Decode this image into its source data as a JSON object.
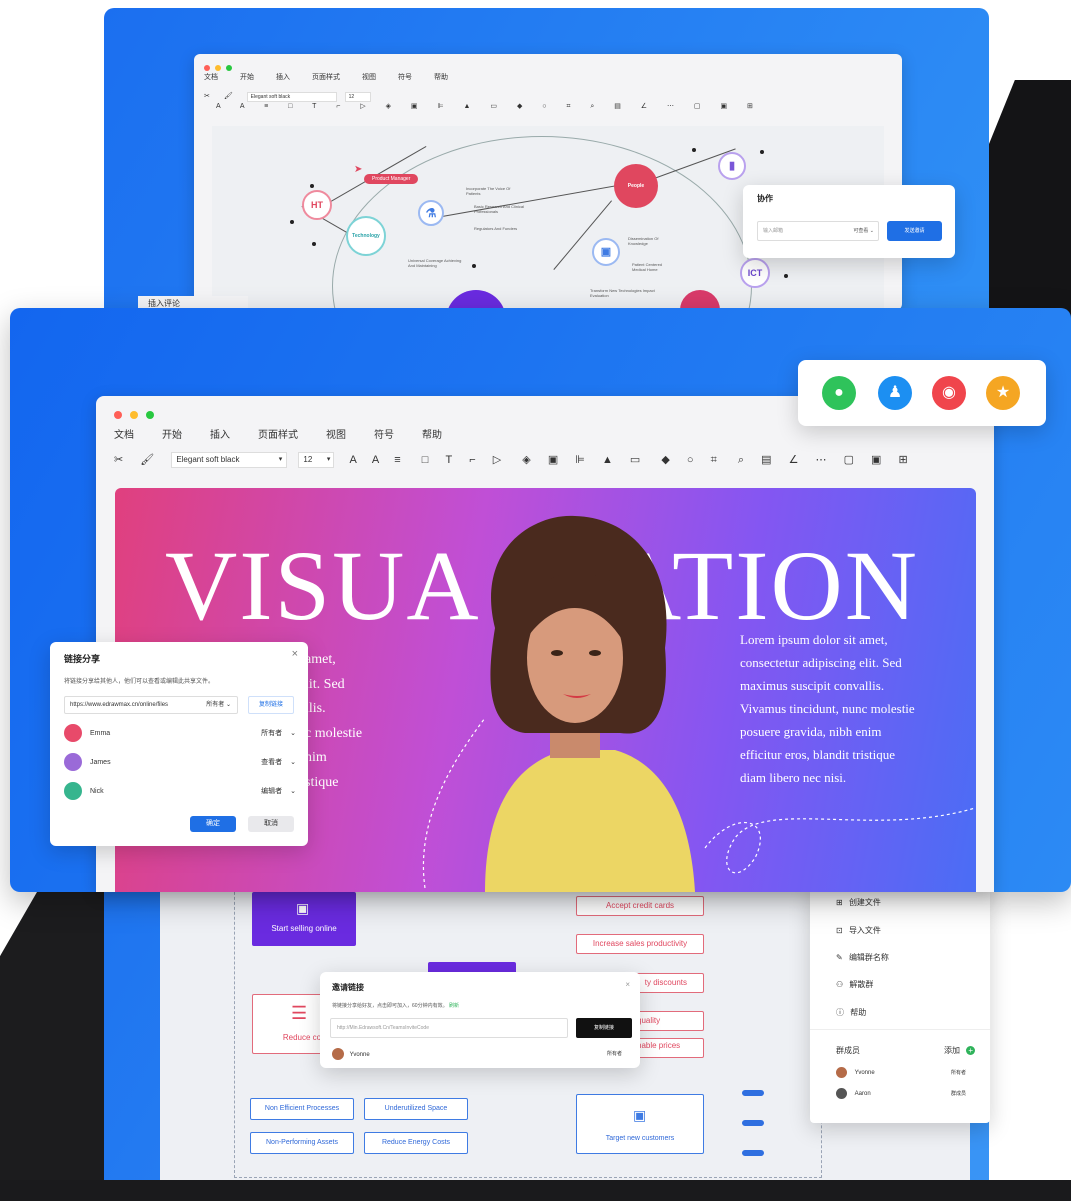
{
  "menu": [
    "文档",
    "开始",
    "插入",
    "页面样式",
    "视图",
    "符号",
    "帮助"
  ],
  "toolbar": {
    "font": "Elegant soft black",
    "size": "12"
  },
  "mindmap": {
    "nodes": {
      "ht": "HT",
      "technology": "Technology",
      "people": "People",
      "ict": "ICT",
      "product_manager": "Product Manager"
    },
    "notes": [
      "Incorporate The Voice Of Patients",
      "Basic Research And Clinical Professionals",
      "Regulators And Funders",
      "Universal Coverage Achieving And Maintaining",
      "Dissemination Of Knowledge",
      "Patient Centered Medical Home",
      "Transform New Technologies Impact Evaluation"
    ],
    "bottom_label": "插入评论"
  },
  "collab": {
    "title": "协作",
    "input_placeholder": "输入邮箱",
    "permission": "可查看",
    "send": "发送邀请"
  },
  "social": {
    "colors": [
      "#2fc35b",
      "#1c8ff2",
      "#f0454c",
      "#f5a623"
    ],
    "icons": [
      "wechat-icon",
      "qq-icon",
      "weibo-icon",
      "favorite-icon"
    ]
  },
  "hero": {
    "title_left": "VISUA",
    "title_right": "ATION",
    "body": "Lorem ipsum dolor sit amet, consectetur adipiscing elit. Sed maximus suscipit convallis. Vivamus tincidunt, nunc molestie posuere gravida, nibh enim efficitur eros, blandit tristique diam libero nec nisi.",
    "body_left_fragments": [
      "amet,",
      "lit. Sed",
      "llis.",
      "c molestie",
      "nim",
      "stique"
    ]
  },
  "share": {
    "title": "链接分享",
    "desc": "将链接分享给其他人，他们可以查看或编辑此共享文件。",
    "url": "https://www.edrawmax.cn/online/files",
    "url_perm": "所有者",
    "copy": "复制链接",
    "users": [
      {
        "name": "Emma",
        "role": "所有者",
        "color": "#e84a6a"
      },
      {
        "name": "James",
        "role": "查看者",
        "color": "#9a6ad8"
      },
      {
        "name": "Nick",
        "role": "编辑者",
        "color": "#36b58e"
      }
    ],
    "ok": "确定",
    "cancel": "取消"
  },
  "flow": {
    "start": "Start selling online",
    "reduce": "Reduce co",
    "right_boxes": [
      "Accept credit cards",
      "Increase sales productivity",
      "ty discounts",
      "quality",
      "nable prices"
    ],
    "bottom_boxes": [
      "Non Efficient Processes",
      "Underutilized Space",
      "Non-Performing Assets",
      "Reduce Energy Costs"
    ],
    "target": "Target new customers"
  },
  "invite": {
    "title": "邀请链接",
    "desc": "将链接分享给好友，点击即可加入，60分钟内有效。",
    "reset": "刷新",
    "url": "http://Min.Edrawsoft.Cn/TeamsInviteCode",
    "copy": "复制链接",
    "user": "Yvonne",
    "role": "所有者"
  },
  "group": {
    "menu": [
      "创建文件",
      "导入文件",
      "编辑群名称",
      "解散群",
      "帮助"
    ],
    "menu_icons": [
      "create-file-icon",
      "import-file-icon",
      "edit-icon",
      "dissolve-icon",
      "help-icon"
    ],
    "members_label": "群成员",
    "add": "添加",
    "members": [
      {
        "name": "Yvonne",
        "role": "所有者"
      },
      {
        "name": "Aaron",
        "role": "群成员"
      }
    ]
  }
}
